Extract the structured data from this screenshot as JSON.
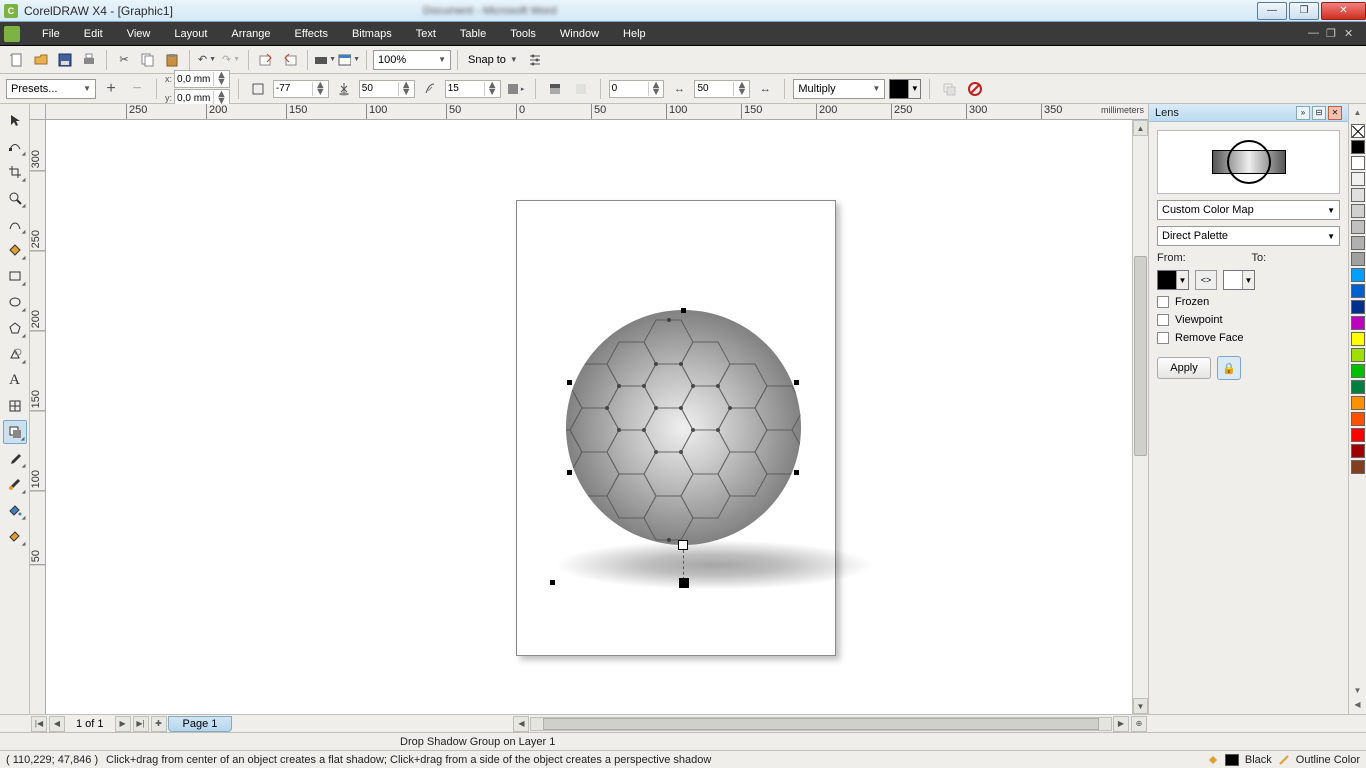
{
  "title": "CorelDRAW X4 - [Graphic1]",
  "menus": [
    "File",
    "Edit",
    "View",
    "Layout",
    "Arrange",
    "Effects",
    "Bitmaps",
    "Text",
    "Table",
    "Tools",
    "Window",
    "Help"
  ],
  "toolbar1": {
    "zoom": "100%",
    "snap_label": "Snap to"
  },
  "propbar": {
    "presets_label": "Presets...",
    "x": "0,0 mm",
    "y": "0,0 mm",
    "angle": "-77",
    "opacity": "50",
    "feather": "15",
    "fade": "0",
    "stretch": "50",
    "blend_mode": "Multiply"
  },
  "ruler_units": "millimeters",
  "ruler_h": [
    "250",
    "200",
    "150",
    "100",
    "50",
    "0",
    "50",
    "100",
    "150",
    "200",
    "250",
    "300",
    "350"
  ],
  "ruler_v": [
    "300",
    "250",
    "200",
    "150",
    "100",
    "50"
  ],
  "docker": {
    "title": "Lens",
    "type": "Custom Color Map",
    "palette": "Direct Palette",
    "from_label": "From:",
    "to_label": "To:",
    "from_color": "#000000",
    "to_color": "#ffffff",
    "frozen": "Frozen",
    "viewpoint": "Viewpoint",
    "remove_face": "Remove Face",
    "apply": "Apply"
  },
  "palette_colors": [
    "#000000",
    "#ffffff",
    "#e0e0e0",
    "#c0c0c0",
    "#a0a0a0",
    "#808080",
    "#00a0e0",
    "#0060c0",
    "#003090",
    "#001060",
    "#ffff00",
    "#a0ff00",
    "#00c000",
    "#008000",
    "#ff9000",
    "#ff6000",
    "#ff3000",
    "#c00000"
  ],
  "pagenav": {
    "count": "1 of 1",
    "tab": "Page 1"
  },
  "hint": "Drop Shadow Group on Layer 1",
  "status": {
    "coords": "( 110,229; 47,846 )",
    "tip": "Click+drag from center of an object creates a flat shadow; Click+drag from a side of the object creates a perspective shadow",
    "fill_label": "Black",
    "outline_label": "Outline Color"
  }
}
